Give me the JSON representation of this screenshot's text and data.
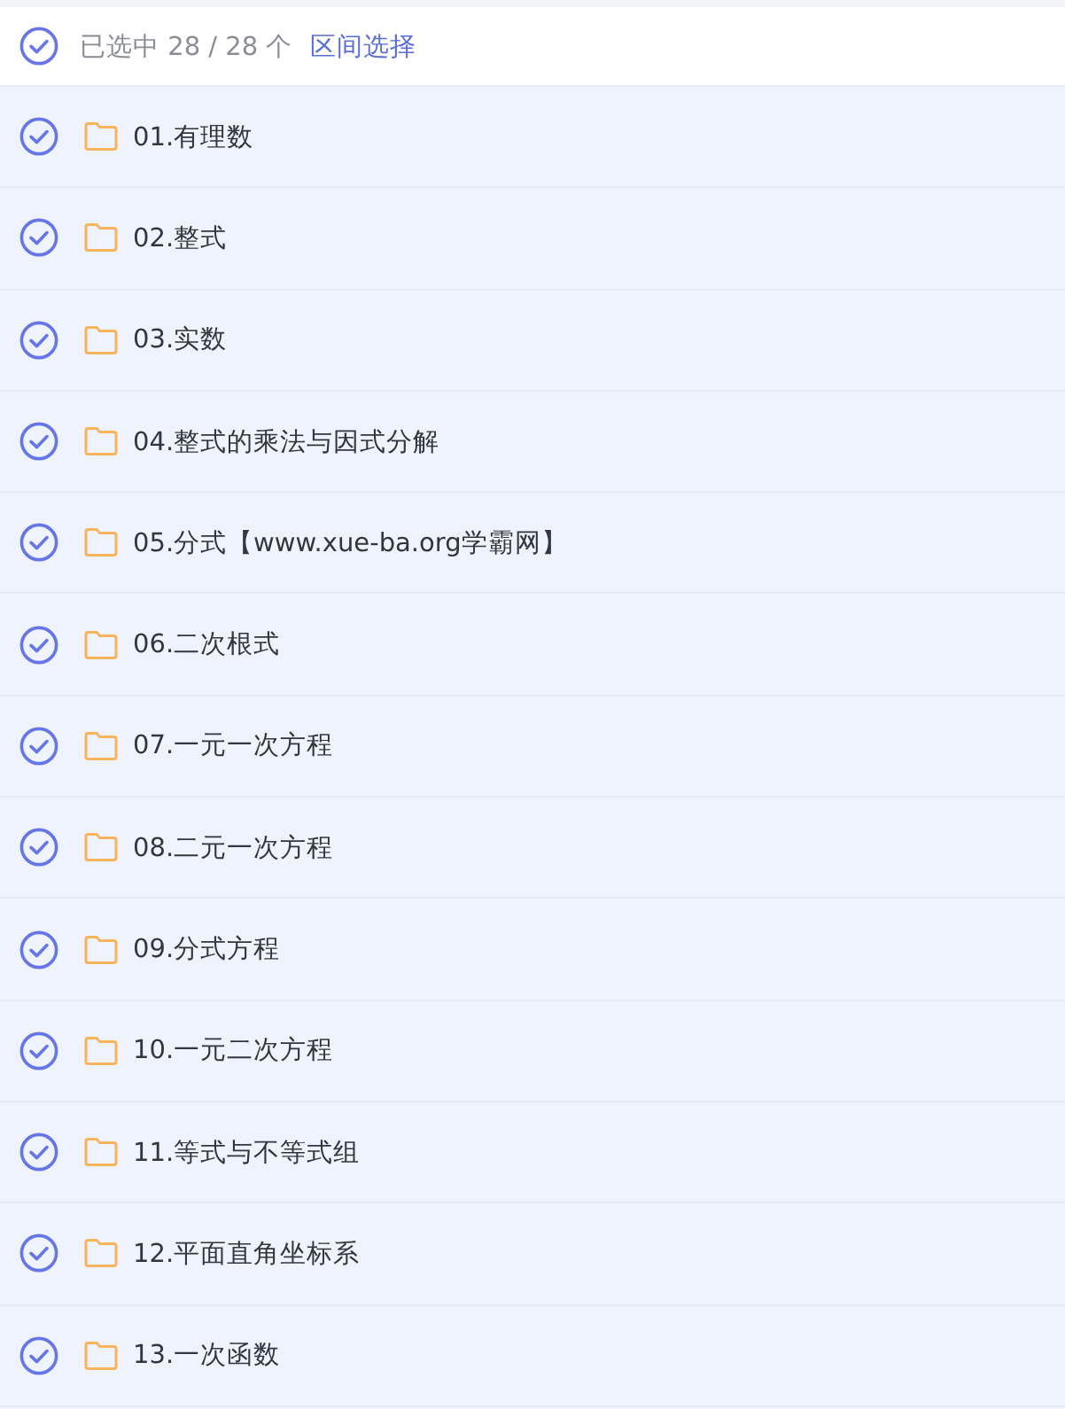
{
  "header": {
    "checked": true,
    "count_text": "已选中 28 / 28 个",
    "range_link": "区间选择"
  },
  "items": [
    {
      "name": "01.有理数",
      "checked": true
    },
    {
      "name": "02.整式",
      "checked": true
    },
    {
      "name": "03.实数",
      "checked": true
    },
    {
      "name": "04.整式的乘法与因式分解",
      "checked": true
    },
    {
      "name": "05.分式【www.xue-ba.org学霸网】",
      "checked": true
    },
    {
      "name": "06.二次根式",
      "checked": true
    },
    {
      "name": "07.一元一次方程",
      "checked": true
    },
    {
      "name": "08.二元一次方程",
      "checked": true
    },
    {
      "name": "09.分式方程",
      "checked": true
    },
    {
      "name": "10.一元二次方程",
      "checked": true
    },
    {
      "name": "11.等式与不等式组",
      "checked": true
    },
    {
      "name": "12.平面直角坐标系",
      "checked": true
    },
    {
      "name": "13.一次函数",
      "checked": true
    }
  ]
}
